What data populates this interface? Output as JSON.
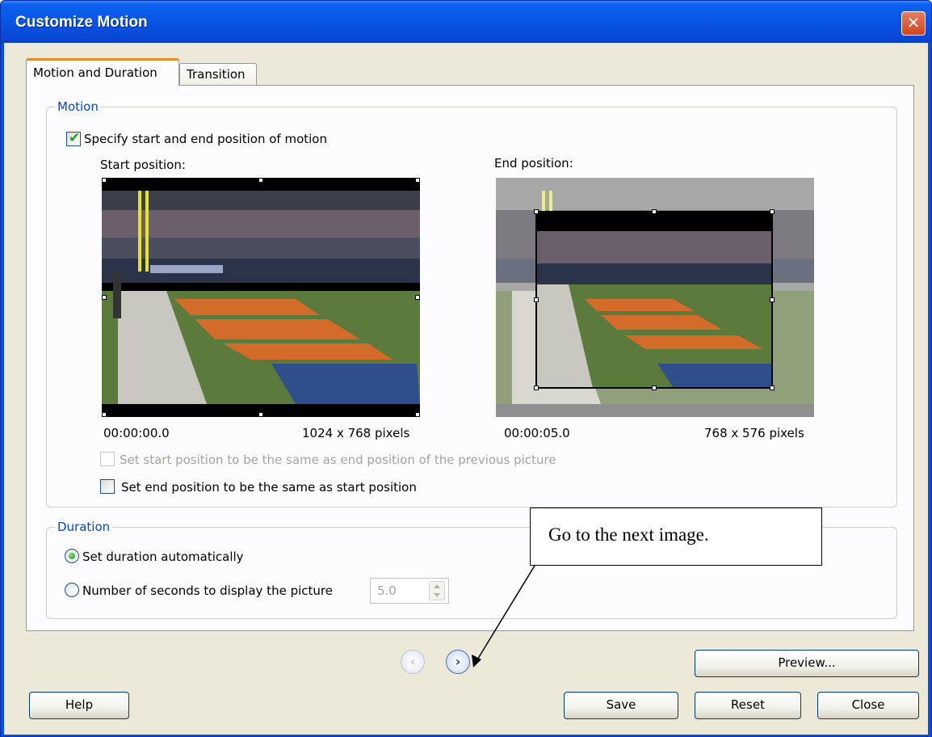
{
  "window": {
    "title": "Customize Motion",
    "close_glyph": "✕"
  },
  "tabs": [
    {
      "label": "Motion and Duration",
      "active": true
    },
    {
      "label": "Transition",
      "active": false
    }
  ],
  "motion": {
    "group_label": "Motion",
    "specify_checkbox": {
      "label": "Specify start and end position of motion",
      "checked": true
    },
    "start": {
      "heading": "Start position:",
      "time": "00:00:00.0",
      "size": "1024 x 768 pixels"
    },
    "end": {
      "heading": "End position:",
      "time": "00:00:05.0",
      "size": "768 x 576 pixels"
    },
    "same_as_previous": {
      "label": "Set start position to be the same as end position of the previous picture",
      "checked": false,
      "enabled": false
    },
    "end_same_as_start": {
      "label": "Set end position to be the same as start position",
      "checked": false
    }
  },
  "duration": {
    "group_label": "Duration",
    "auto_radio": {
      "label": "Set duration automatically",
      "selected": true
    },
    "seconds_radio": {
      "label": "Number of seconds to display the picture",
      "selected": false
    },
    "seconds_value": "5.0"
  },
  "nav": {
    "prev_glyph": "‹",
    "next_glyph": "›"
  },
  "buttons": {
    "preview": "Preview...",
    "help": "Help",
    "save": "Save",
    "reset": "Reset",
    "close": "Close"
  },
  "callout": {
    "text": "Go to the next image."
  },
  "colors": {
    "titlebar": "#0a56e6",
    "dialog_bg": "#ece9d8",
    "group_label": "#0046d5",
    "active_tab_accent": "#e68b2c"
  }
}
